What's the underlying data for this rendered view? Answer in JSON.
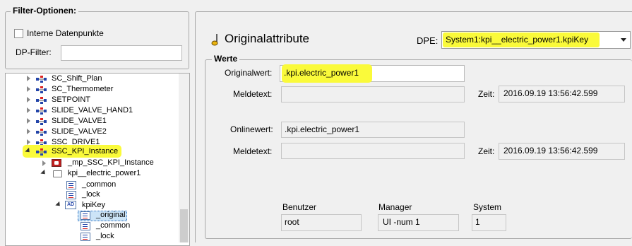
{
  "filter": {
    "title": "Filter-Optionen:",
    "internal_label": "Interne Datenpunkte",
    "internal_checked": false,
    "dp_filter_label": "DP-Filter:",
    "dp_filter_value": ""
  },
  "tree": {
    "items": [
      {
        "label": "SC_Shift_Plan"
      },
      {
        "label": "SC_Thermometer"
      },
      {
        "label": "SETPOINT"
      },
      {
        "label": "SLIDE_VALVE_HAND1"
      },
      {
        "label": "SLIDE_VALVE1"
      },
      {
        "label": "SLIDE_VALVE2"
      },
      {
        "label": "SSC_DRIVE1"
      },
      {
        "label": "SSC_KPI_Instance"
      },
      {
        "label": "_mp_SSC_KPI_Instance"
      },
      {
        "label": "kpi__electric_power1"
      },
      {
        "label": "_common"
      },
      {
        "label": "_lock"
      },
      {
        "label": "kpiKey"
      },
      {
        "label": "_original"
      },
      {
        "label": "_common"
      },
      {
        "label": "_lock"
      }
    ],
    "ad_icon_text": "AD"
  },
  "panel": {
    "title": "Originalattribute",
    "dpe_label": "DPE:",
    "dpe_value": "System1:kpi__electric_power1.kpiKey",
    "group_title": "Werte",
    "original_value_label": "Originalwert:",
    "original_value": ".kpi.electric_power1",
    "message_label_1": "Meldetext:",
    "message_value_1": "",
    "time_label_1": "Zeit:",
    "time_value_1": "2016.09.19 13:56:42.599",
    "online_value_label": "Onlinewert:",
    "online_value": ".kpi.electric_power1",
    "message_label_2": "Meldetext:",
    "message_value_2": "",
    "time_label_2": "Zeit:",
    "time_value_2": "2016.09.19 13:56:42.599",
    "user_label": "Benutzer",
    "user_value": "root",
    "manager_label": "Manager",
    "manager_value": "UI -num 1",
    "system_label": "System",
    "system_value": "1"
  },
  "colors": {
    "highlight": "#fafa3a",
    "selection": "#cce4f7"
  }
}
